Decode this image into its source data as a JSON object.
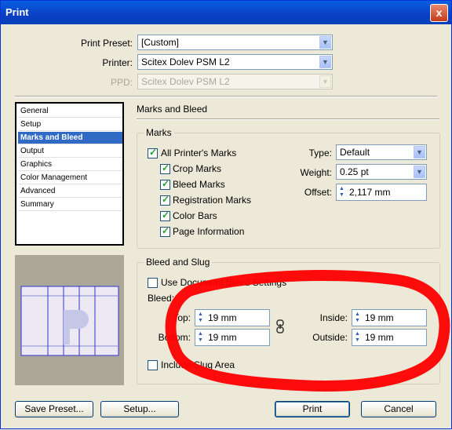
{
  "window": {
    "title": "Print",
    "close_glyph": "x"
  },
  "top": {
    "print_preset_label": "Print Preset:",
    "print_preset_value": "[Custom]",
    "printer_label": "Printer:",
    "printer_value": "Scitex Dolev PSM L2",
    "ppd_label": "PPD:",
    "ppd_value": "Scitex Dolev PSM L2"
  },
  "nav": {
    "items": [
      "General",
      "Setup",
      "Marks and Bleed",
      "Output",
      "Graphics",
      "Color Management",
      "Advanced",
      "Summary"
    ],
    "selected": "Marks and Bleed"
  },
  "section_title": "Marks and Bleed",
  "marks": {
    "title": "Marks",
    "all_printers_marks": "All Printer's Marks",
    "crop_marks": "Crop Marks",
    "bleed_marks": "Bleed Marks",
    "registration_marks": "Registration Marks",
    "color_bars": "Color Bars",
    "page_information": "Page Information",
    "type_label": "Type:",
    "type_value": "Default",
    "weight_label": "Weight:",
    "weight_value": "0.25 pt",
    "offset_label": "Offset:",
    "offset_value": "2,117 mm"
  },
  "bleed": {
    "title": "Bleed and Slug",
    "use_document_bleed": "Use Document Bleed Settings",
    "bleed_label": "Bleed:",
    "top_label": "Top:",
    "top_value": "19 mm",
    "bottom_label": "Bottom:",
    "bottom_value": "19 mm",
    "inside_label": "Inside:",
    "inside_value": "19 mm",
    "outside_label": "Outside:",
    "outside_value": "19 mm",
    "include_slug": "Include Slug Area"
  },
  "buttons": {
    "save_preset": "Save Preset...",
    "setup": "Setup...",
    "print": "Print",
    "cancel": "Cancel"
  },
  "colors": {
    "annotation_circle": "#ff0000",
    "selection": "#316ac5"
  }
}
